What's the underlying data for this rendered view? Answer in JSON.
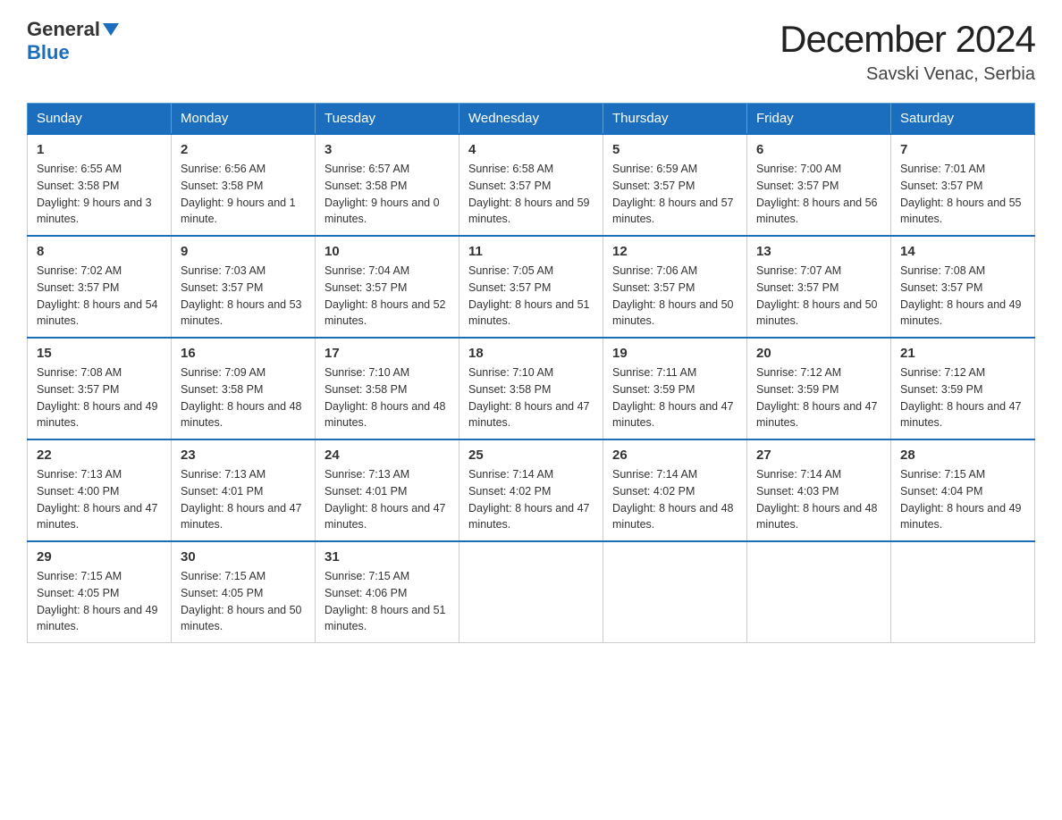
{
  "header": {
    "logo": {
      "general": "General",
      "blue": "Blue"
    },
    "title": "December 2024",
    "location": "Savski Venac, Serbia"
  },
  "days_of_week": [
    "Sunday",
    "Monday",
    "Tuesday",
    "Wednesday",
    "Thursday",
    "Friday",
    "Saturday"
  ],
  "weeks": [
    [
      {
        "num": "1",
        "sunrise": "6:55 AM",
        "sunset": "3:58 PM",
        "daylight": "9 hours and 3 minutes."
      },
      {
        "num": "2",
        "sunrise": "6:56 AM",
        "sunset": "3:58 PM",
        "daylight": "9 hours and 1 minute."
      },
      {
        "num": "3",
        "sunrise": "6:57 AM",
        "sunset": "3:58 PM",
        "daylight": "9 hours and 0 minutes."
      },
      {
        "num": "4",
        "sunrise": "6:58 AM",
        "sunset": "3:57 PM",
        "daylight": "8 hours and 59 minutes."
      },
      {
        "num": "5",
        "sunrise": "6:59 AM",
        "sunset": "3:57 PM",
        "daylight": "8 hours and 57 minutes."
      },
      {
        "num": "6",
        "sunrise": "7:00 AM",
        "sunset": "3:57 PM",
        "daylight": "8 hours and 56 minutes."
      },
      {
        "num": "7",
        "sunrise": "7:01 AM",
        "sunset": "3:57 PM",
        "daylight": "8 hours and 55 minutes."
      }
    ],
    [
      {
        "num": "8",
        "sunrise": "7:02 AM",
        "sunset": "3:57 PM",
        "daylight": "8 hours and 54 minutes."
      },
      {
        "num": "9",
        "sunrise": "7:03 AM",
        "sunset": "3:57 PM",
        "daylight": "8 hours and 53 minutes."
      },
      {
        "num": "10",
        "sunrise": "7:04 AM",
        "sunset": "3:57 PM",
        "daylight": "8 hours and 52 minutes."
      },
      {
        "num": "11",
        "sunrise": "7:05 AM",
        "sunset": "3:57 PM",
        "daylight": "8 hours and 51 minutes."
      },
      {
        "num": "12",
        "sunrise": "7:06 AM",
        "sunset": "3:57 PM",
        "daylight": "8 hours and 50 minutes."
      },
      {
        "num": "13",
        "sunrise": "7:07 AM",
        "sunset": "3:57 PM",
        "daylight": "8 hours and 50 minutes."
      },
      {
        "num": "14",
        "sunrise": "7:08 AM",
        "sunset": "3:57 PM",
        "daylight": "8 hours and 49 minutes."
      }
    ],
    [
      {
        "num": "15",
        "sunrise": "7:08 AM",
        "sunset": "3:57 PM",
        "daylight": "8 hours and 49 minutes."
      },
      {
        "num": "16",
        "sunrise": "7:09 AM",
        "sunset": "3:58 PM",
        "daylight": "8 hours and 48 minutes."
      },
      {
        "num": "17",
        "sunrise": "7:10 AM",
        "sunset": "3:58 PM",
        "daylight": "8 hours and 48 minutes."
      },
      {
        "num": "18",
        "sunrise": "7:10 AM",
        "sunset": "3:58 PM",
        "daylight": "8 hours and 47 minutes."
      },
      {
        "num": "19",
        "sunrise": "7:11 AM",
        "sunset": "3:59 PM",
        "daylight": "8 hours and 47 minutes."
      },
      {
        "num": "20",
        "sunrise": "7:12 AM",
        "sunset": "3:59 PM",
        "daylight": "8 hours and 47 minutes."
      },
      {
        "num": "21",
        "sunrise": "7:12 AM",
        "sunset": "3:59 PM",
        "daylight": "8 hours and 47 minutes."
      }
    ],
    [
      {
        "num": "22",
        "sunrise": "7:13 AM",
        "sunset": "4:00 PM",
        "daylight": "8 hours and 47 minutes."
      },
      {
        "num": "23",
        "sunrise": "7:13 AM",
        "sunset": "4:01 PM",
        "daylight": "8 hours and 47 minutes."
      },
      {
        "num": "24",
        "sunrise": "7:13 AM",
        "sunset": "4:01 PM",
        "daylight": "8 hours and 47 minutes."
      },
      {
        "num": "25",
        "sunrise": "7:14 AM",
        "sunset": "4:02 PM",
        "daylight": "8 hours and 47 minutes."
      },
      {
        "num": "26",
        "sunrise": "7:14 AM",
        "sunset": "4:02 PM",
        "daylight": "8 hours and 48 minutes."
      },
      {
        "num": "27",
        "sunrise": "7:14 AM",
        "sunset": "4:03 PM",
        "daylight": "8 hours and 48 minutes."
      },
      {
        "num": "28",
        "sunrise": "7:15 AM",
        "sunset": "4:04 PM",
        "daylight": "8 hours and 49 minutes."
      }
    ],
    [
      {
        "num": "29",
        "sunrise": "7:15 AM",
        "sunset": "4:05 PM",
        "daylight": "8 hours and 49 minutes."
      },
      {
        "num": "30",
        "sunrise": "7:15 AM",
        "sunset": "4:05 PM",
        "daylight": "8 hours and 50 minutes."
      },
      {
        "num": "31",
        "sunrise": "7:15 AM",
        "sunset": "4:06 PM",
        "daylight": "8 hours and 51 minutes."
      },
      null,
      null,
      null,
      null
    ]
  ],
  "labels": {
    "sunrise_prefix": "Sunrise: ",
    "sunset_prefix": "Sunset: ",
    "daylight_prefix": "Daylight: "
  }
}
